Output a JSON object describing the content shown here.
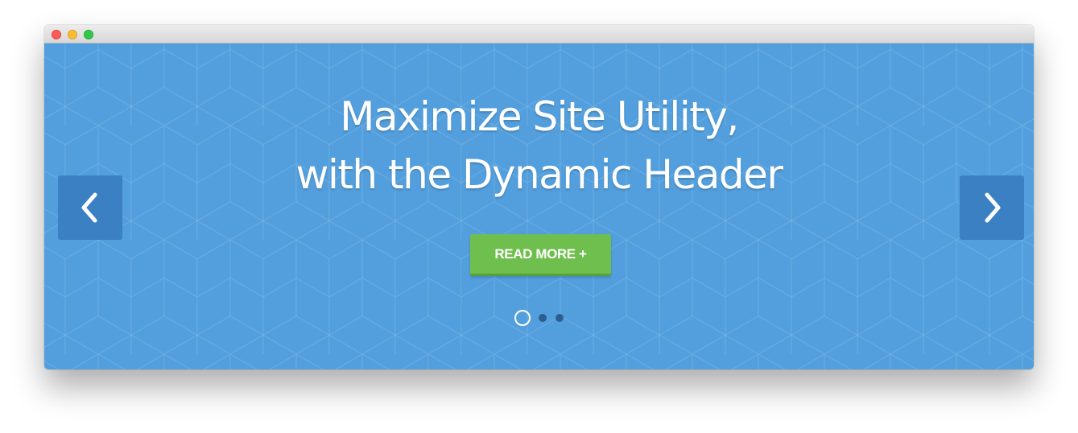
{
  "window": {
    "controls": [
      "close",
      "minimize",
      "zoom"
    ]
  },
  "hero": {
    "headline_line1": "Maximize Site Utility,",
    "headline_line2": "with the Dynamic Header",
    "cta_label": "READ MORE +",
    "prev_icon": "chevron-left-icon",
    "next_icon": "chevron-right-icon",
    "slides_total": 3,
    "active_slide": 1
  },
  "colors": {
    "background": "#539fdd",
    "nav_button": "#3b80c2",
    "cta_button": "#6fbf4e",
    "inactive_dot": "#2c5f8f",
    "text": "#ffffff"
  }
}
